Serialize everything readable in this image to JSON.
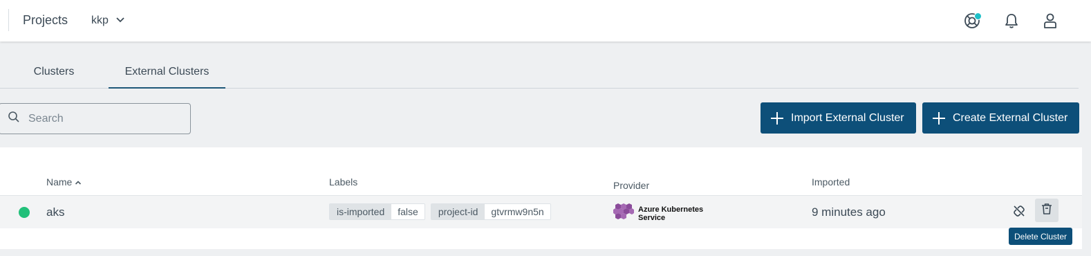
{
  "topbar": {
    "projects_label": "Projects",
    "project_name": "kkp",
    "icons": [
      "help-icon",
      "bell-icon",
      "user-icon",
      "chevron-down-icon"
    ],
    "notification_dot_color": "#1fc0c8"
  },
  "tabs": [
    {
      "label": "Clusters",
      "active": false
    },
    {
      "label": "External Clusters",
      "active": true
    }
  ],
  "search": {
    "placeholder": "Search",
    "value": ""
  },
  "actions": {
    "import_label": "Import External Cluster",
    "create_label": "Create External Cluster",
    "button_color": "#0d4f79"
  },
  "table": {
    "columns": {
      "name": "Name",
      "labels": "Labels",
      "provider": "Provider",
      "imported": "Imported"
    },
    "sort": {
      "column": "Name",
      "direction": "ascending"
    },
    "rows": [
      {
        "status_color": "#22c07a",
        "name": "aks",
        "labels": [
          {
            "key": "is-imported",
            "value": "false"
          },
          {
            "key": "project-id",
            "value": "gtvrmw9n5n"
          }
        ],
        "provider": "Azure Kubernetes Service",
        "imported": "9 minutes ago"
      }
    ]
  },
  "tooltip": "Delete Cluster"
}
